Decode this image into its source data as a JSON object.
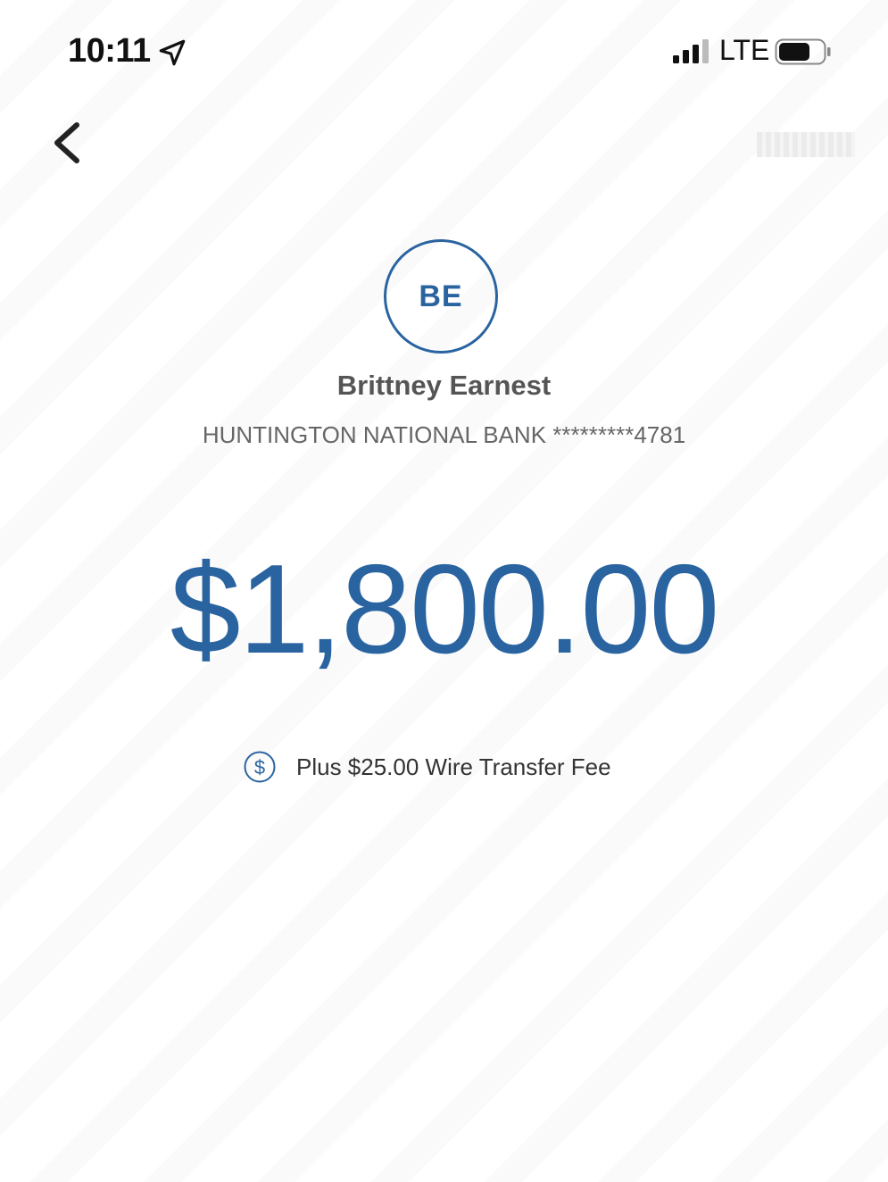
{
  "status_bar": {
    "time": "10:11",
    "network": "LTE",
    "icons": [
      "location-arrow-icon",
      "signal-bars-icon",
      "battery-icon"
    ]
  },
  "nav": {
    "back_icon": "chevron-left-icon"
  },
  "recipient": {
    "initials": "BE",
    "name": "Brittney Earnest",
    "account": "HUNTINGTON NATIONAL BANK *********4781"
  },
  "transfer": {
    "amount": "$1,800.00",
    "fee_text": "Plus $25.00 Wire Transfer Fee",
    "fee_icon": "dollar-coin-icon"
  },
  "colors": {
    "accent": "#2a64a0",
    "text_primary": "#111111",
    "text_secondary": "#555555"
  }
}
